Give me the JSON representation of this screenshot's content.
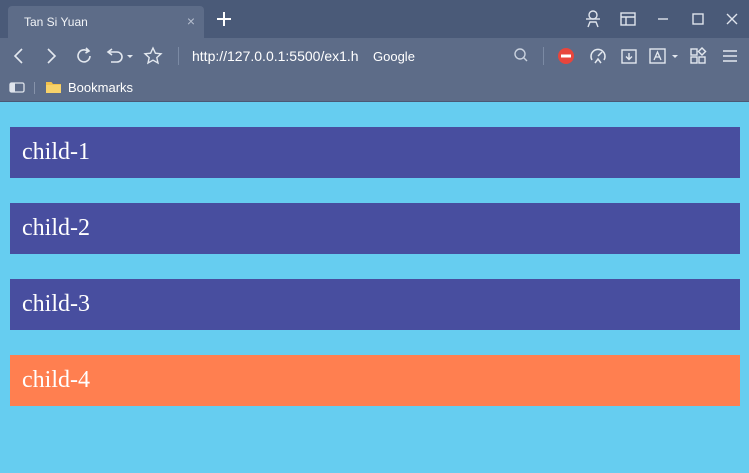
{
  "browser": {
    "tab": {
      "title": "Tan Si Yuan",
      "close_glyph": "×"
    },
    "address": {
      "url": "http://127.0.0.1:5500/ex1.h"
    },
    "search": {
      "engine_label": "Google"
    },
    "bookmarks_bar": {
      "folder_label": "Bookmarks"
    },
    "colors": {
      "tab_strip": "#4a5a78",
      "toolbar": "#5d6c88",
      "page_bg": "#66cdf0",
      "block_purple": "#484e9f",
      "block_orange": "#ff7f50",
      "adblock_red": "#e8453c"
    }
  },
  "page": {
    "children": [
      {
        "label": "child-1",
        "color": "#484e9f"
      },
      {
        "label": "child-2",
        "color": "#484e9f"
      },
      {
        "label": "child-3",
        "color": "#484e9f"
      },
      {
        "label": "child-4",
        "color": "#ff7f50"
      }
    ]
  }
}
